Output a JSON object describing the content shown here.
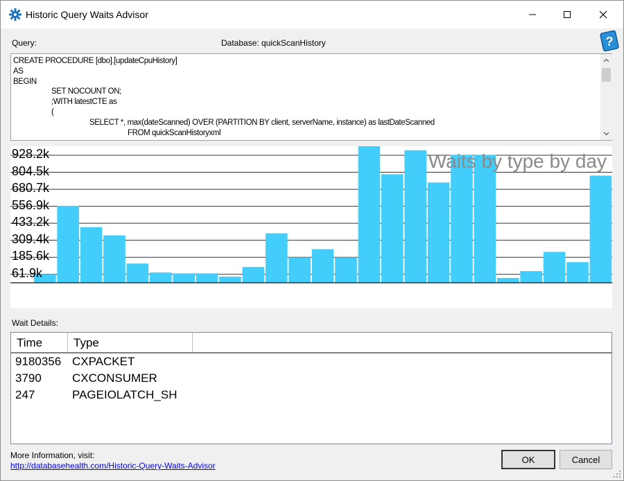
{
  "window": {
    "title": "Historic Query Waits Advisor",
    "app_icon": "gear-icon",
    "controls": [
      "minimize-icon",
      "maximize-icon",
      "close-icon"
    ]
  },
  "query": {
    "label": "Query:",
    "database_label": "Database: quickScanHistory",
    "lines": [
      "CREATE PROCEDURE [dbo].[updateCpuHistory]",
      "AS",
      "BEGIN",
      "\t\tSET NOCOUNT ON;",
      "\t\t;WITH latestCTE as",
      "\t\t(",
      "\t\t\t\tSELECT *, max(dateScanned) OVER (PARTITION BY client, serverName, instance) as lastDateScanned",
      "\t\t\t\t\t\tFROM quickScanHistoryxml"
    ]
  },
  "chart_data": {
    "type": "bar",
    "title": "Waits by type by day",
    "ytick_labels": [
      "928.2k",
      "804.5k",
      "680.7k",
      "556.9k",
      "433.2k",
      "309.4k",
      "185.6k",
      "61.9k"
    ],
    "ytick_values": [
      928200,
      804500,
      680700,
      556900,
      433200,
      309400,
      185600,
      61900
    ],
    "values": [
      62000,
      560000,
      405000,
      345000,
      140000,
      75000,
      68000,
      68000,
      45000,
      115000,
      360000,
      185000,
      245000,
      185000,
      1020000,
      790000,
      965000,
      730000,
      930000,
      930000,
      35000,
      85000,
      225000,
      150000,
      780000
    ],
    "color": "#43cdfb",
    "grid": true
  },
  "details": {
    "label": "Wait Details:",
    "columns": [
      "Time",
      "Type"
    ],
    "rows": [
      {
        "time": "9180356",
        "type": "CXPACKET"
      },
      {
        "time": "3790",
        "type": "CXCONSUMER"
      },
      {
        "time": "247",
        "type": "PAGEIOLATCH_SH"
      }
    ]
  },
  "footer": {
    "more_info": "More Information, visit:",
    "link": "http://databasehealth.com/Historic-Query-Waits-Advisor",
    "ok_label": "OK",
    "cancel_label": "Cancel"
  },
  "help_icon": "help-book-icon"
}
